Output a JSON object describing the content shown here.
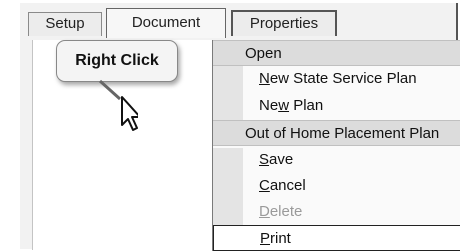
{
  "tabs": [
    {
      "label": "Setup"
    },
    {
      "label": "Document"
    },
    {
      "label": "Properties"
    }
  ],
  "callout": {
    "text": "Right Click"
  },
  "menu": {
    "sections": [
      {
        "header": "Open",
        "items": [
          {
            "label": "New State Service Plan",
            "mnemonic_index": 0,
            "enabled": true
          },
          {
            "label": "New Plan",
            "mnemonic_index": 2,
            "enabled": true
          }
        ]
      },
      {
        "header": "Out of Home Placement Plan",
        "items": [
          {
            "label": "Save",
            "mnemonic_index": 0,
            "enabled": true
          },
          {
            "label": "Cancel",
            "mnemonic_index": 0,
            "enabled": true
          },
          {
            "label": "Delete",
            "mnemonic_index": 0,
            "enabled": false
          },
          {
            "label": "Print",
            "mnemonic_index": 0,
            "enabled": true,
            "selected": true
          }
        ]
      }
    ]
  },
  "icons": {
    "cursor": "mouse-pointer-icon"
  }
}
